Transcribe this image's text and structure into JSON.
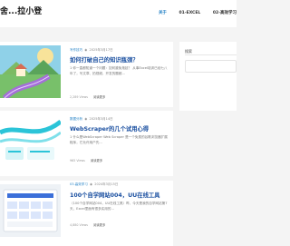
{
  "site": {
    "logo": "舍...拉小登"
  },
  "nav": {
    "items": [
      "关于",
      "01-EXCEL",
      "02-高效学习"
    ],
    "active_index": 0
  },
  "sidebar": {
    "search_label": "搜索"
  },
  "posts": [
    {
      "category": "写作技巧",
      "date": "2025年3月17日",
      "title": "如何打破自己的知识瓶颈？",
      "excerpt": "1 你一直都知道一个问题：如何避免拖延？ 从事Excel培训已经七八年了，写文章、拍视频、开发的题都...",
      "views": "2,289 Views",
      "more": "阅读更多"
    },
    {
      "category": "数据分析",
      "date": "2025年3月14日",
      "title": "WebScraper的几个试用心得",
      "excerpt": "1 什么是WebScraper Web Scraper 是一个免费的谷歌浏览器扩展程序，它允许用户先...",
      "views": "965 Views",
      "more": "阅读更多"
    },
    {
      "category": "03-高效学习",
      "date": "2024年3月15日",
      "title": "100个自学网站004，UU在线工具",
      "excerpt": "（100个自学网站004，UU在线工具）昨，今天是我的自学网站第7天，Excel里面有很多实用的...",
      "views": "4,880 Views",
      "more": "阅读更多"
    }
  ]
}
